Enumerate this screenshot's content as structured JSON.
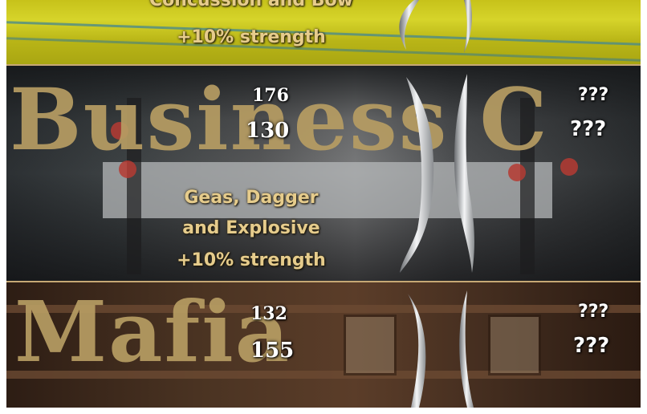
{
  "top_faction": {
    "weapons_text": "Concussion and Bow",
    "bonus_text": "+10% strength"
  },
  "business_faction": {
    "name": "Business C",
    "stat_1": "176",
    "stat_2": "130",
    "unknown_1": "???",
    "unknown_2": "???",
    "weapons_line_1": "Geas, Dagger",
    "weapons_line_2": "and Explosive",
    "bonus_text": "+10% strength"
  },
  "mafia_faction": {
    "name": "Mafia",
    "stat_1": "132",
    "stat_2": "155",
    "unknown_1": "???",
    "unknown_2": "???"
  },
  "colors": {
    "title_gold": "#b79d63",
    "text_gold": "#e6cc8c",
    "divider_gold": "#c6a874",
    "top_band_yellow": "#c7c21a"
  },
  "icons": [
    "blade-icon"
  ]
}
